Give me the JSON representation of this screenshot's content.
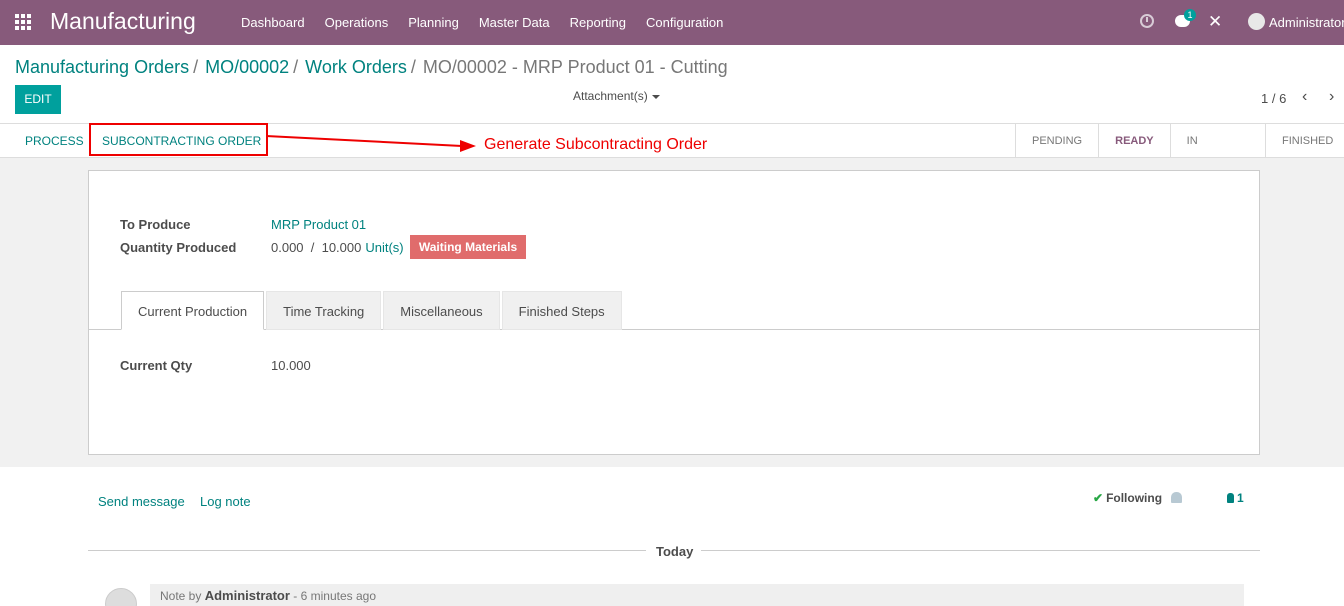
{
  "navbar": {
    "app_title": "Manufacturing",
    "menu": [
      "Dashboard",
      "Operations",
      "Planning",
      "Master Data",
      "Reporting",
      "Configuration"
    ],
    "chat_badge": "1",
    "user": "Administrator",
    "bg_color": "#875a7b"
  },
  "breadcrumb": {
    "items": [
      "Manufacturing Orders",
      "MO/00002",
      "Work Orders"
    ],
    "separator": "/",
    "current": "MO/00002 - MRP Product 01 - Cutting"
  },
  "control": {
    "edit_label": "EDIT",
    "attachments_label": "Attachment(s)",
    "pager": "1 / 6",
    "prev_icon": "‹",
    "next_icon": "›"
  },
  "header": {
    "process_label": "PROCESS",
    "subcontract_label": "SUBCONTRACTING ORDER",
    "annotation": "Generate Subcontracting Order",
    "stages": [
      "PENDING",
      "READY",
      "IN PROGRESS",
      "FINISHED"
    ],
    "active_stage": "READY"
  },
  "form": {
    "to_produce_label": "To Produce",
    "product": "MRP Product 01",
    "qty_produced_label": "Quantity Produced",
    "qty_produced": "0.000  /  10.000",
    "uom": "Unit(s)",
    "status_badge": "Waiting Materials",
    "tabs": [
      "Current Production",
      "Time Tracking",
      "Miscellaneous",
      "Finished Steps"
    ],
    "active_tab": "Current Production",
    "current_qty_label": "Current Qty",
    "current_qty": "10.000"
  },
  "chatter": {
    "send_message": "Send message",
    "log_note": "Log note",
    "following": "Following",
    "followers_count": "1",
    "date_divider": "Today",
    "note_prefix": "Note by",
    "note_author": "Administrator",
    "note_time": "- 6 minutes ago"
  }
}
